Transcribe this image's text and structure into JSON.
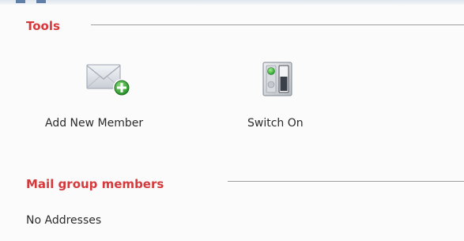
{
  "tools_section": {
    "title": "Tools",
    "items": [
      {
        "label": "Add New Member",
        "icon": "envelope-add-icon"
      },
      {
        "label": "Switch On",
        "icon": "switch-icon"
      }
    ]
  },
  "members_section": {
    "title": "Mail group members",
    "empty_text": "No Addresses"
  },
  "colors": {
    "section_title": "#d6393b",
    "rule": "#9c9c9c",
    "add_badge": "#3aa53a"
  }
}
